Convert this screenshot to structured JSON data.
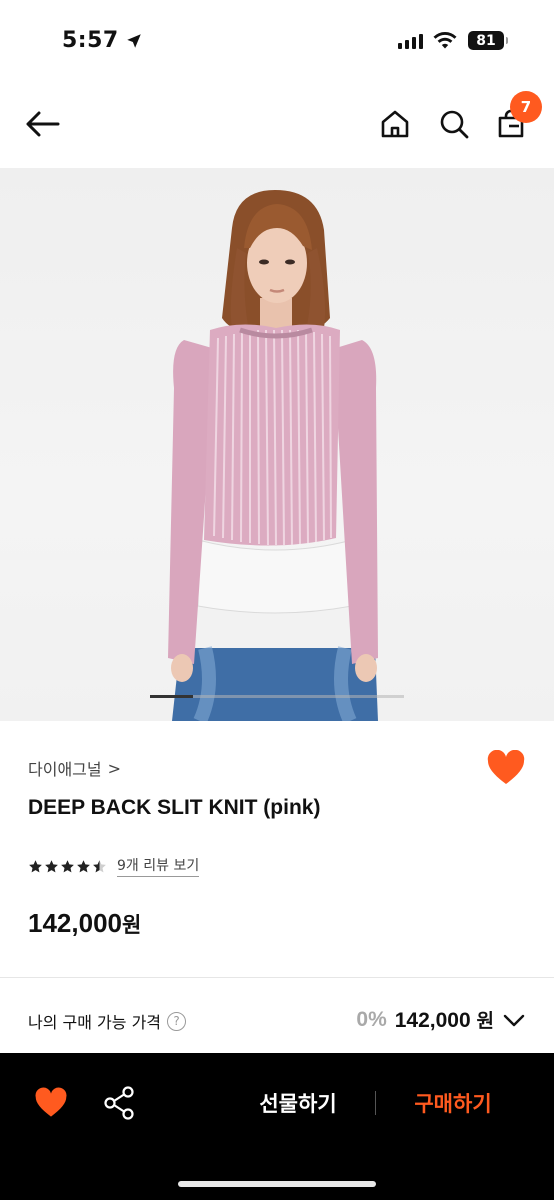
{
  "status_bar": {
    "time": "5:57",
    "battery": "81"
  },
  "nav": {
    "cart_count": "7"
  },
  "gallery": {
    "current_slide_fraction": 0.17
  },
  "product": {
    "brand": "다이애그널",
    "brand_chevron": ">",
    "name": "DEEP BACK SLIT KNIT (pink)",
    "rating": 4.5,
    "review_link": "9개 리뷰 보기",
    "price": "142,000",
    "price_unit": "원",
    "liked": true
  },
  "my_price": {
    "label": "나의 구매 가능 가격",
    "help": "?",
    "discount": "0%",
    "price": "142,000",
    "unit": "원"
  },
  "bottom_bar": {
    "gift_label": "선물하기",
    "buy_label": "구매하기"
  },
  "colors": {
    "accent": "#ff5a1f",
    "bottom_bar_bg": "#000000"
  }
}
